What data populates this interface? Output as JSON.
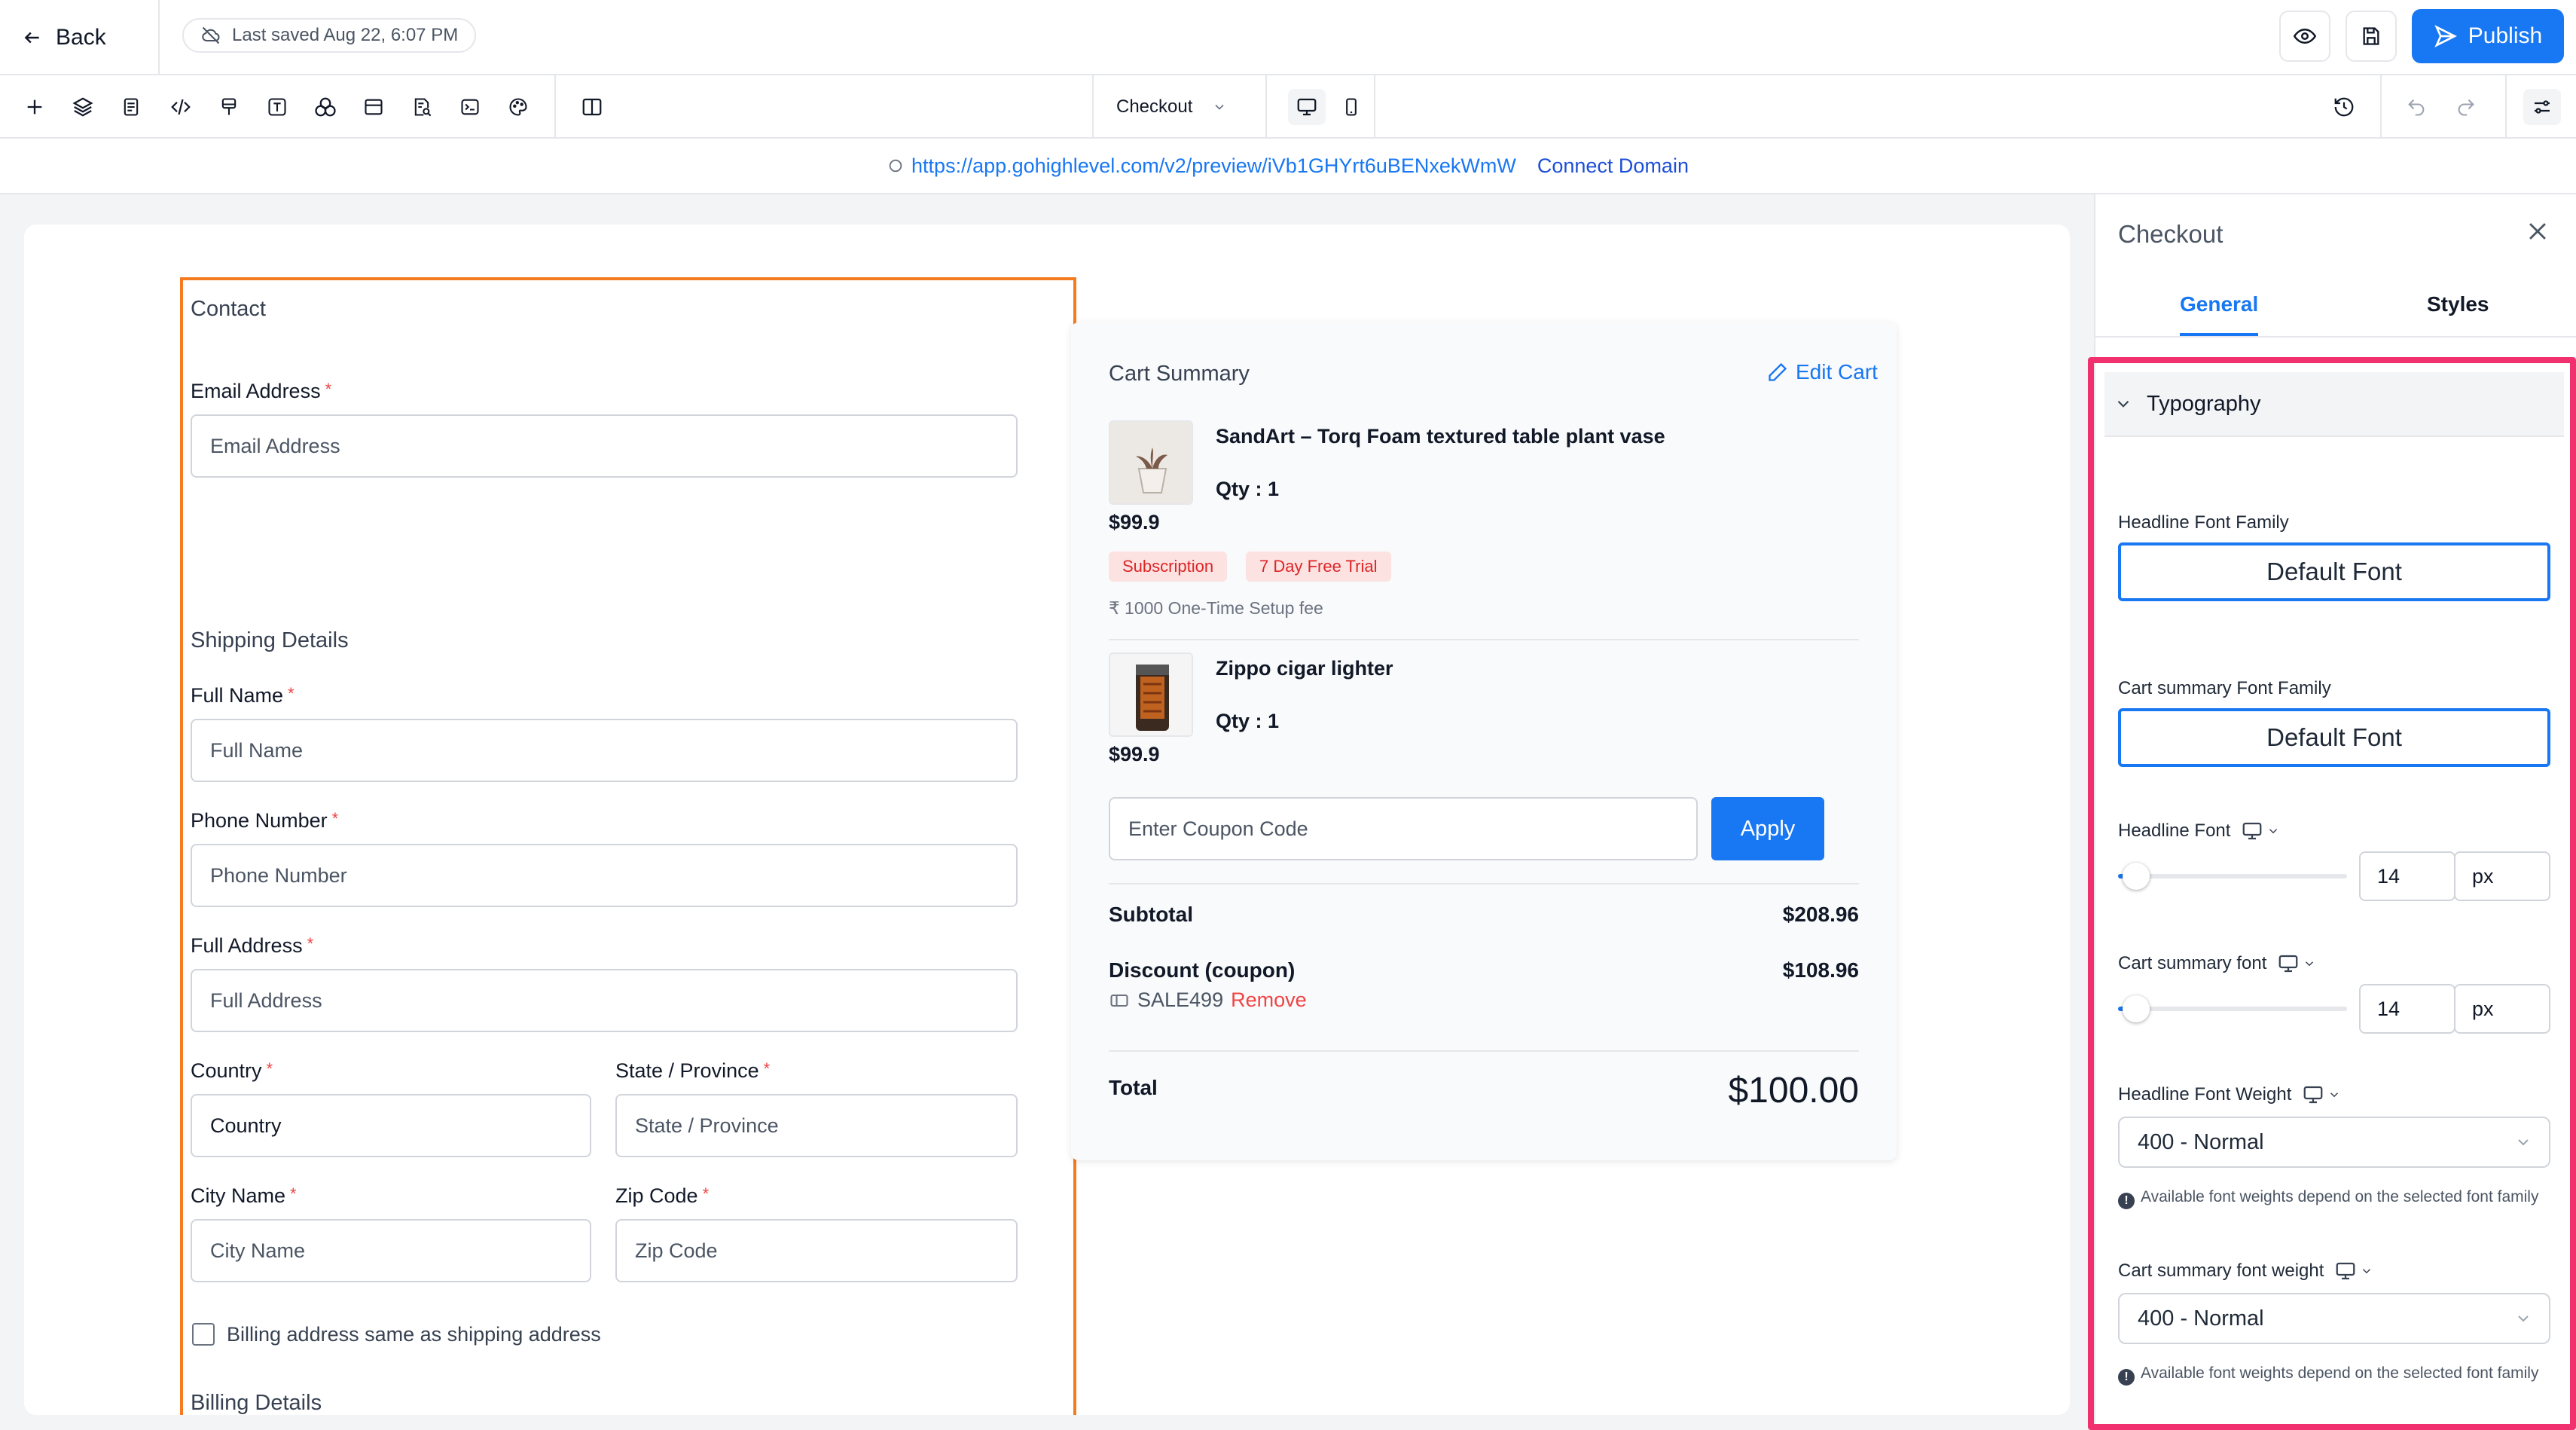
{
  "topbar": {
    "back_label": "Back",
    "last_saved": "Last saved Aug 22, 6:07 PM",
    "publish_label": "Publish"
  },
  "toolbar": {
    "page_selector": "Checkout",
    "tools": [
      "plus-icon",
      "layers-icon",
      "page-icon",
      "code-icon",
      "paint-icon",
      "text-icon",
      "shapes-icon",
      "layout-icon",
      "search-doc-icon",
      "terminal-icon",
      "palette-icon",
      "columns-icon"
    ]
  },
  "urlbar": {
    "url": "https://app.gohighlevel.com/v2/preview/iVb1GHYrt6uBENxekWmW",
    "connect_label": "Connect Domain"
  },
  "form": {
    "contact_title": "Contact",
    "email_label": "Email Address",
    "email_placeholder": "Email Address",
    "shipping_title": "Shipping Details",
    "full_name_label": "Full Name",
    "full_name_placeholder": "Full Name",
    "phone_label": "Phone Number",
    "phone_placeholder": "Phone Number",
    "address_label": "Full Address",
    "address_placeholder": "Full Address",
    "country_label": "Country",
    "country_value": "Country",
    "state_label": "State / Province",
    "state_placeholder": "State / Province",
    "city_label": "City Name",
    "city_placeholder": "City Name",
    "zip_label": "Zip Code",
    "zip_placeholder": "Zip Code",
    "billing_same_label": "Billing address same as shipping address",
    "billing_title": "Billing Details",
    "required_mark": "*"
  },
  "cart": {
    "title": "Cart Summary",
    "edit_label": "Edit Cart",
    "items": [
      {
        "name": "SandArt – Torq Foam textured table plant vase",
        "qty": "Qty : 1",
        "price": "$99.9",
        "tags": [
          "Subscription",
          "7 Day Free Trial"
        ],
        "setup_fee": "₹ 1000 One-Time Setup fee"
      },
      {
        "name": "Zippo cigar lighter",
        "qty": "Qty : 1",
        "price": "$99.9"
      }
    ],
    "coupon_placeholder": "Enter Coupon Code",
    "apply_label": "Apply",
    "subtotal_label": "Subtotal",
    "subtotal_value": "$208.96",
    "discount_label": "Discount (coupon)",
    "discount_value": "$108.96",
    "coupon_code": "SALE499",
    "remove_label": "Remove",
    "total_label": "Total",
    "total_value": "$100.00"
  },
  "panel": {
    "title": "Checkout",
    "tabs": [
      "General",
      "Styles"
    ],
    "active_tab": "General",
    "section_title": "Typography",
    "headline_font_family_label": "Headline Font Family",
    "headline_font_family_value": "Default Font",
    "cart_font_family_label": "Cart summary Font Family",
    "cart_font_family_value": "Default Font",
    "headline_font_label": "Headline Font",
    "headline_font_size": "14",
    "headline_font_level": 0.08,
    "cart_font_label": "Cart summary font",
    "cart_font_size": "14",
    "cart_font_level": 0.08,
    "unit": "px",
    "headline_weight_label": "Headline Font Weight",
    "headline_weight_value": "400 - Normal",
    "cart_weight_label": "Cart summary font weight",
    "cart_weight_value": "400 - Normal",
    "weight_note": "Available font weights depend on the selected font family",
    "info_glyph": "!"
  },
  "colors": {
    "accent": "#1877f2",
    "frame_border": "#f47b20",
    "highlight": "#f0306f",
    "required": "#ef4444"
  }
}
